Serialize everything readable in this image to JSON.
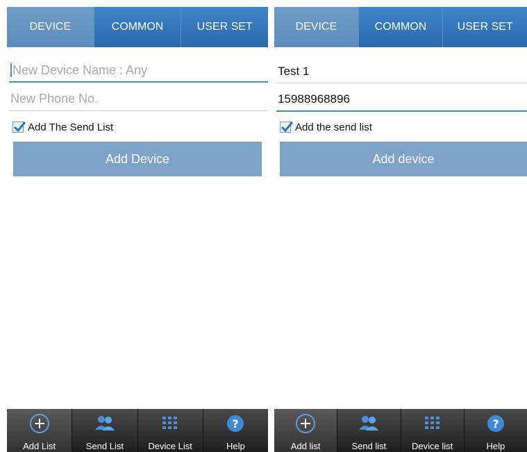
{
  "left": {
    "tabs": [
      "DEVICE",
      "COMMON",
      "USER SET"
    ],
    "name_placeholder": "New Device Name : Any",
    "phone_placeholder": "New Phone No.",
    "checkbox_label": "Add The Send List",
    "button_label": "Add Device",
    "nav": [
      {
        "label": "Add List",
        "icon": "plus-circle-icon"
      },
      {
        "label": "Send List",
        "icon": "people-icon"
      },
      {
        "label": "Device List",
        "icon": "grid-icon"
      },
      {
        "label": "Help",
        "icon": "help-icon"
      }
    ]
  },
  "right": {
    "tabs": [
      "DEVICE",
      "COMMON",
      "USER SET"
    ],
    "name_value": "Test 1",
    "phone_value": "15988968896",
    "checkbox_label": "Add the send list",
    "button_label": "Add device",
    "nav": [
      {
        "label": "Add list",
        "icon": "plus-circle-icon"
      },
      {
        "label": "Send list",
        "icon": "people-icon"
      },
      {
        "label": "Device list",
        "icon": "grid-icon"
      },
      {
        "label": "Help",
        "icon": "help-icon"
      }
    ]
  },
  "colors": {
    "tab_bar": "#2f75b8",
    "active_tab": "#6c9cc8",
    "button": "#7da3c8",
    "focus_line": "#3e8fd8",
    "bottom_bar": "#2a2a2a"
  }
}
